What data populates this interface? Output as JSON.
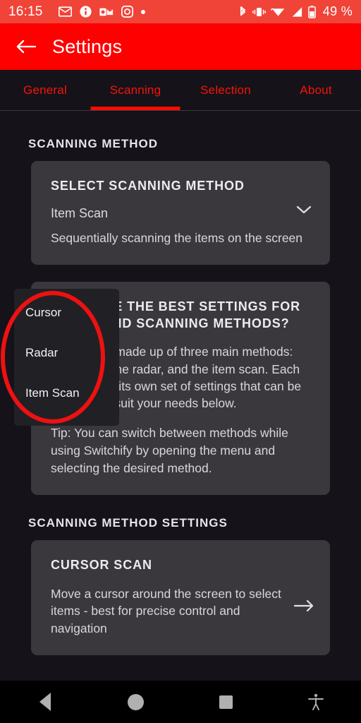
{
  "status_bar": {
    "time": "16:15",
    "left_icons": [
      {
        "name": "mail-icon",
        "label": "mail"
      },
      {
        "name": "info-icon",
        "label": "info"
      },
      {
        "name": "outlook-icon",
        "label": "outlook"
      },
      {
        "name": "instagram-icon",
        "label": "instagram"
      },
      {
        "name": "more-dot-icon",
        "label": "more"
      }
    ],
    "right_icons": [
      {
        "name": "bluetooth-icon",
        "label": "bluetooth"
      },
      {
        "name": "vibrate-icon",
        "label": "vibrate"
      },
      {
        "name": "wifi-icon",
        "label": "wifi"
      },
      {
        "name": "cellular-signal-icon",
        "label": "signal"
      },
      {
        "name": "battery-icon",
        "label": "battery"
      }
    ],
    "battery_text": "49 %",
    "background_color": "#f04438"
  },
  "app_bar": {
    "title": "Settings",
    "back_label": "Back",
    "background_color": "#ff0000"
  },
  "tabs": [
    {
      "label": "General",
      "active": false
    },
    {
      "label": "Scanning",
      "active": true
    },
    {
      "label": "Selection",
      "active": false
    },
    {
      "label": "About",
      "active": false
    }
  ],
  "accent_color": "#fa0c00",
  "sections": {
    "scanning_method": {
      "heading": "SCANNING METHOD",
      "card": {
        "title": "SELECT SCANNING METHOD",
        "value": "Item Scan",
        "description": "Sequentially scanning the items on the screen",
        "chevron": "chevron-down"
      }
    },
    "info": {
      "title": "WHAT ARE THE BEST SETTINGS FOR TIMING AND SCANNING METHODS?",
      "paragraph_1": "Switchify is made up of three main methods: the cursor, the radar, and the item scan. Each method has its own set of settings that can be adjusted to suit your needs below.",
      "paragraph_2": "Tip: You can switch between methods while using Switchify by opening the menu and selecting the desired method."
    },
    "scanning_method_settings": {
      "heading": "SCANNING METHOD SETTINGS",
      "card": {
        "title": "CURSOR SCAN",
        "description": "Move a cursor around the screen to select items - best for precise control and navigation",
        "arrow": "arrow-right"
      }
    }
  },
  "dropdown": {
    "open": true,
    "options": [
      {
        "label": "Cursor"
      },
      {
        "label": "Radar"
      },
      {
        "label": "Item Scan"
      }
    ]
  },
  "annotation": {
    "shape": "ellipse",
    "color": "#ee1111"
  },
  "nav_bar": {
    "buttons": [
      {
        "name": "nav-back-button",
        "label": "Back"
      },
      {
        "name": "nav-home-button",
        "label": "Home"
      },
      {
        "name": "nav-recents-button",
        "label": "Recents"
      },
      {
        "name": "nav-accessibility-button",
        "label": "Accessibility"
      }
    ]
  }
}
